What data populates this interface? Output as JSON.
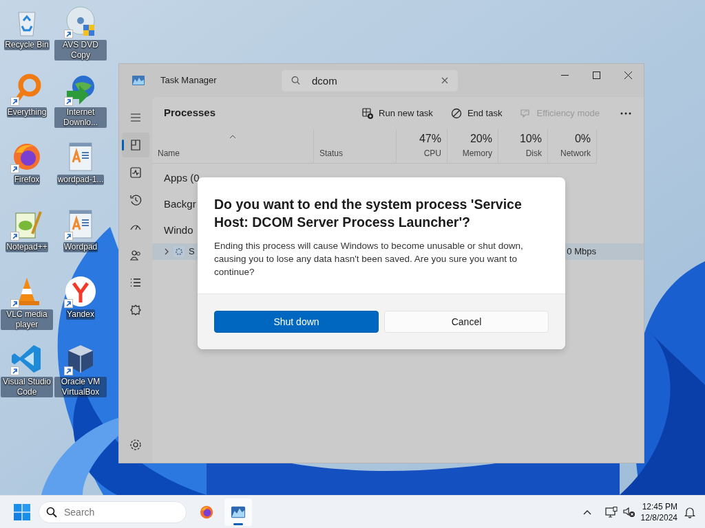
{
  "desktop_icons": [
    {
      "label": "Recycle Bin",
      "shortcut": false
    },
    {
      "label": "AVS DVD Copy",
      "shortcut": true
    },
    {
      "label": "Everything",
      "shortcut": true
    },
    {
      "label": "Internet Downlo...",
      "shortcut": true
    },
    {
      "label": "Firefox",
      "shortcut": true
    },
    {
      "label": "wordpad-1...",
      "shortcut": false
    },
    {
      "label": "Notepad++",
      "shortcut": true
    },
    {
      "label": "Wordpad",
      "shortcut": true
    },
    {
      "label": "VLC media player",
      "shortcut": true
    },
    {
      "label": "Yandex",
      "shortcut": true
    },
    {
      "label": "Visual Studio Code",
      "shortcut": true
    },
    {
      "label": "Oracle VM VirtualBox",
      "shortcut": true
    }
  ],
  "task_manager": {
    "title": "Task Manager",
    "search": {
      "value": "dcom"
    },
    "nav_items": [
      {
        "selected": false
      },
      {
        "selected": true
      },
      {
        "selected": false
      },
      {
        "selected": false
      },
      {
        "selected": false
      },
      {
        "selected": false
      },
      {
        "selected": false
      },
      {
        "selected": false
      },
      {
        "selected": false
      }
    ],
    "page_title": "Processes",
    "toolbar": [
      {
        "label": "Run new task",
        "disabled": false
      },
      {
        "label": "End task",
        "disabled": false
      },
      {
        "label": "Efficiency mode",
        "disabled": true
      }
    ],
    "columns": [
      {
        "label": "Name"
      },
      {
        "label": "Status"
      },
      {
        "label": "CPU",
        "reading": "47%"
      },
      {
        "label": "Memory",
        "reading": "20%"
      },
      {
        "label": "Disk",
        "reading": "10%"
      },
      {
        "label": "Network",
        "reading": "0%"
      }
    ],
    "groups": [
      "Apps (0",
      "Backgr",
      "Windo"
    ],
    "process_row": {
      "name": "S",
      "network": "0 Mbps",
      "selected": true,
      "expanded": false
    }
  },
  "dialog": {
    "title": "Do you want to end the system process 'Service Host: DCOM Server Process Launcher'?",
    "message": "Ending this process will cause Windows to become unusable or shut down, causing you to lose any data hasn't been saved. Are you sure you want to continue?",
    "buttons": [
      {
        "label": "Shut down",
        "primary": true
      },
      {
        "label": "Cancel",
        "primary": false
      }
    ]
  },
  "taskbar": {
    "search": {
      "placeholder": "Search"
    },
    "apps": [
      {
        "active": false
      },
      {
        "active": true
      }
    ],
    "time": "12:45 PM",
    "date": "12/8/2024"
  }
}
